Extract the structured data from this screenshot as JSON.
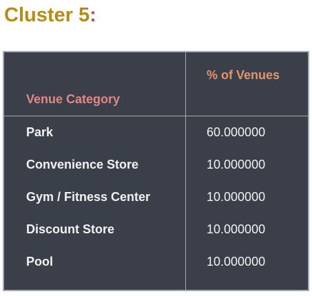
{
  "heading": {
    "text": "Cluster 5",
    "colon": ":"
  },
  "table": {
    "columns": [
      "Venue Category",
      "% of Venues"
    ],
    "rows": [
      {
        "category": "Park",
        "percent": "60.000000"
      },
      {
        "category": "Convenience Store",
        "percent": "10.000000"
      },
      {
        "category": "Gym / Fitness Center",
        "percent": "10.000000"
      },
      {
        "category": "Discount Store",
        "percent": "10.000000"
      },
      {
        "category": "Pool",
        "percent": "10.000000"
      }
    ]
  }
}
